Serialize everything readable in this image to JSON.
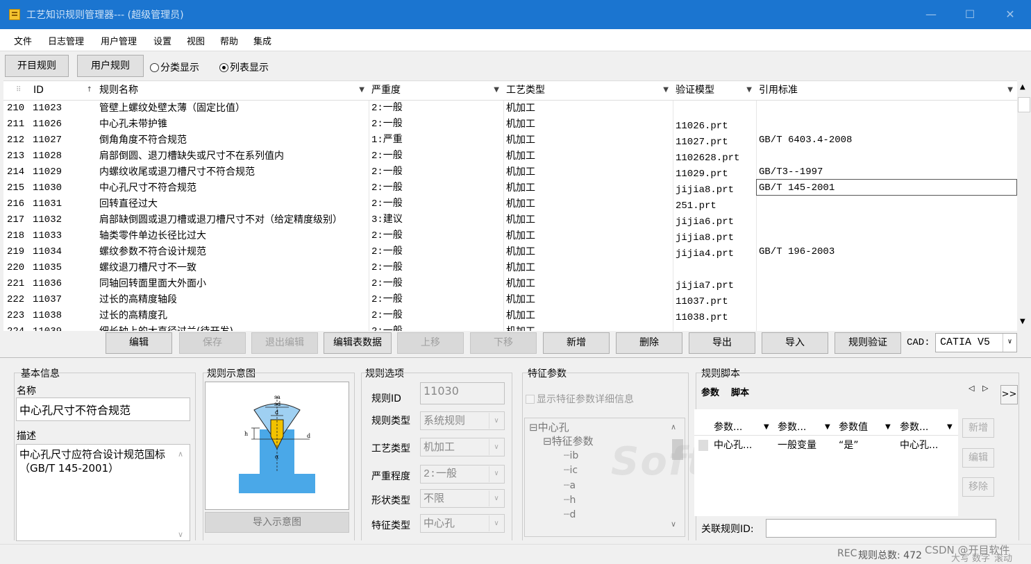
{
  "window": {
    "title": "工艺知识规则管理器--- (超级管理员)",
    "minimize": "—",
    "maximize": "☐",
    "close": "✕"
  },
  "menu": [
    "文件",
    "日志管理",
    "用户管理",
    "设置",
    "视图",
    "帮助",
    "集成"
  ],
  "toolbar": {
    "tab1": "开目规则",
    "tab2": "用户规则",
    "radio_category": "分类显示",
    "radio_list": "列表显示",
    "selected": "列表显示"
  },
  "grid": {
    "columns": [
      {
        "label": "ID",
        "icon": "↑"
      },
      {
        "label": "规则名称",
        "icon": "▼"
      },
      {
        "label": "严重度",
        "icon": "▼"
      },
      {
        "label": "工艺类型",
        "icon": "▼"
      },
      {
        "label": "验证模型",
        "icon": "▼"
      },
      {
        "label": "引用标准",
        "icon": "▼"
      }
    ],
    "rows": [
      {
        "n": "210",
        "id": "11023",
        "name": "管壁上螺纹处壁太薄（固定比值）",
        "sev": "2:一般",
        "type": "机加工",
        "model": "",
        "std": ""
      },
      {
        "n": "211",
        "id": "11026",
        "name": "中心孔未带护锥",
        "sev": "2:一般",
        "type": "机加工",
        "model": "11026.prt",
        "std": ""
      },
      {
        "n": "212",
        "id": "11027",
        "name": "倒角角度不符合规范",
        "sev": "1:严重",
        "type": "机加工",
        "model": "11027.prt",
        "std": "GB/T 6403.4-2008"
      },
      {
        "n": "213",
        "id": "11028",
        "name": "肩部倒圆、退刀槽缺失或尺寸不在系列值内",
        "sev": "2:一般",
        "type": "机加工",
        "model": "1102628.prt",
        "std": ""
      },
      {
        "n": "214",
        "id": "11029",
        "name": "内螺纹收尾或退刀槽尺寸不符合规范",
        "sev": "2:一般",
        "type": "机加工",
        "model": "11029.prt",
        "std": "GB/T3--1997"
      },
      {
        "n": "215",
        "id": "11030",
        "name": "中心孔尺寸不符合规范",
        "sev": "2:一般",
        "type": "机加工",
        "model": "jijia8.prt",
        "std": "GB/T 145-2001"
      },
      {
        "n": "216",
        "id": "11031",
        "name": "回转直径过大",
        "sev": "2:一般",
        "type": "机加工",
        "model": "251.prt",
        "std": ""
      },
      {
        "n": "217",
        "id": "11032",
        "name": "肩部缺倒圆或退刀槽或退刀槽尺寸不对（给定精度级别）",
        "sev": "3:建议",
        "type": "机加工",
        "model": "jijia6.prt",
        "std": ""
      },
      {
        "n": "218",
        "id": "11033",
        "name": "轴类零件单边长径比过大",
        "sev": "2:一般",
        "type": "机加工",
        "model": "jijia8.prt",
        "std": ""
      },
      {
        "n": "219",
        "id": "11034",
        "name": "螺纹参数不符合设计规范",
        "sev": "2:一般",
        "type": "机加工",
        "model": "jijia4.prt",
        "std": "GB/T 196-2003"
      },
      {
        "n": "220",
        "id": "11035",
        "name": "螺纹退刀槽尺寸不一致",
        "sev": "2:一般",
        "type": "机加工",
        "model": "",
        "std": ""
      },
      {
        "n": "221",
        "id": "11036",
        "name": "同轴回转面里面大外面小",
        "sev": "2:一般",
        "type": "机加工",
        "model": "jijia7.prt",
        "std": ""
      },
      {
        "n": "222",
        "id": "11037",
        "name": "过长的高精度轴段",
        "sev": "2:一般",
        "type": "机加工",
        "model": "11037.prt",
        "std": ""
      },
      {
        "n": "223",
        "id": "11038",
        "name": "过长的高精度孔",
        "sev": "2:一般",
        "type": "机加工",
        "model": "11038.prt",
        "std": ""
      },
      {
        "n": "224",
        "id": "11039",
        "name": "细长轴上的大直径过兰(待开发)",
        "sev": "2:一般",
        "type": "机加工",
        "model": "",
        "std": ""
      }
    ]
  },
  "actions": {
    "edit": "编辑",
    "save": "保存",
    "exit_edit": "退出编辑",
    "edit_table": "编辑表数据",
    "up": "上移",
    "down": "下移",
    "add": "新增",
    "delete": "删除",
    "export": "导出",
    "import": "导入",
    "verify": "规则验证",
    "cad_label": "CAD:",
    "cad_value": "CATIA V5"
  },
  "basic": {
    "group": "基本信息",
    "name_label": "名称",
    "name_value": "中心孔尺寸不符合规范",
    "desc_label": "描述",
    "desc_value": "中心孔尺寸应符合设计规范国标（GB/T 145-2001）"
  },
  "diagram": {
    "group": "规则示意图",
    "import_button": "导入示意图",
    "labels": [
      "sa",
      "sd",
      "d",
      "h",
      "d",
      "α"
    ]
  },
  "options": {
    "group": "规则选项",
    "rule_id_label": "规则ID",
    "rule_id": "11030",
    "rule_type_label": "规则类型",
    "rule_type": "系统规则",
    "process_label": "工艺类型",
    "process": "机加工",
    "severity_label": "严重程度",
    "severity": "2:一般",
    "shape_label": "形状类型",
    "shape": "不限",
    "feature_label": "特征类型",
    "feature": "中心孔"
  },
  "features": {
    "group": "特征参数",
    "show_detail": "显示特征参数详细信息",
    "tree": [
      "中心孔",
      "特征参数",
      "ib",
      "ic",
      "a",
      "h",
      "d"
    ]
  },
  "script": {
    "group": "规则脚本",
    "tab_params": "参数",
    "tab_script": "脚本",
    "cols": [
      "参数...",
      "参数...",
      "参数值",
      "参数..."
    ],
    "row": [
      "中心孔...",
      "一般变量",
      "“是”",
      "中心孔..."
    ],
    "add": "新增",
    "edit": "编辑",
    "remove": "移除",
    "more": ">>",
    "related_label": "关联规则ID:"
  },
  "watermark": "Soft开目",
  "status": {
    "rec": "REC",
    "total": "规则总数: 472",
    "csdn": "CSDN @开目软件",
    "caps": "大写",
    "num": "数字",
    "scroll": "滚动"
  },
  "colors": {
    "titlebar": "#1b75d0",
    "diagram_blue": "#4aa8e8",
    "drill": "#f2c200"
  }
}
